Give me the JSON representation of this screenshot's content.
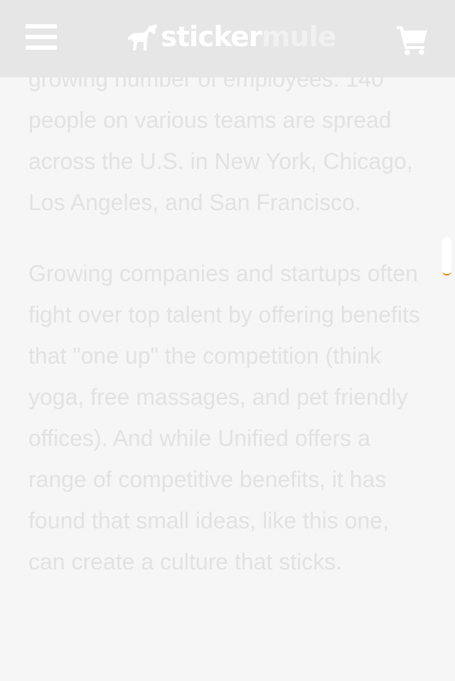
{
  "header": {
    "menu_icon": "hamburger-menu-icon",
    "logo": {
      "part1": "sticker",
      "part2": "mule",
      "mark_icon": "mule-logo-icon"
    },
    "cart_icon": "shopping-cart-icon"
  },
  "article": {
    "paragraphs": [
      "growing number of employees. 140 people on various teams are spread across the U.S. in New York, Chicago, Los Angeles, and San Francisco.",
      "Growing companies and startups often fight over top talent by offering benefits that \"one up\" the competition (think yoga, free massages, and pet friendly offices). And while Unified offers a range of competitive benefits, it has found that small ideas, like this one, can create a culture that sticks."
    ]
  },
  "colors": {
    "header_bg": "#e6e6e6",
    "page_bg": "#f6f6f6",
    "text": "#e2e2e2",
    "scroll_accent": "#e08a00"
  }
}
